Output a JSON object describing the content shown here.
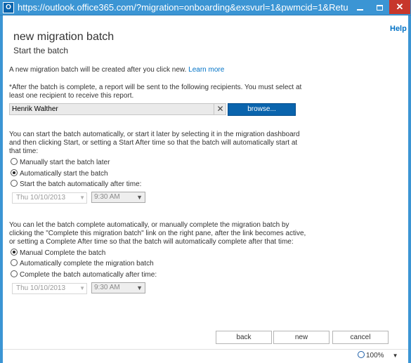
{
  "window": {
    "app_icon_letter": "O",
    "url": "https://outlook.office365.com/?migration=onboarding&exsvurl=1&pwmcid=1&ReturnObj...",
    "min_icon": "minimize-icon",
    "max_icon": "maximize-icon",
    "close_icon": "close-icon",
    "close_glyph": "✕"
  },
  "header": {
    "help_label": "Help",
    "title": "new migration batch",
    "subtitle": "Start the batch"
  },
  "intro": {
    "text": "A new migration batch will be created after you click new.",
    "learn_more": "Learn more"
  },
  "report": {
    "line1": "*After the batch is complete, a report will be sent to the following recipients. You must select at",
    "line2": "least one recipient to receive this report.",
    "recipient": "Henrik Walther",
    "remove_glyph": "✕",
    "browse_label": "browse..."
  },
  "start": {
    "desc_line1": "You can start the batch automatically, or start it later by selecting it in the migration dashboard",
    "desc_line2": "and then clicking Start, or setting a Start After time so that the batch will automatically start at",
    "desc_line3": "that time:",
    "options": [
      {
        "label": "Manually start the batch later",
        "checked": false
      },
      {
        "label": "Automatically start the batch",
        "checked": true
      },
      {
        "label": "Start the batch automatically after time:",
        "checked": false
      }
    ],
    "date": "Thu 10/10/2013",
    "time": "9:30 AM"
  },
  "complete": {
    "desc_line1": "You can let the batch complete automatically, or manually complete the migration batch by",
    "desc_line2": "clicking the \"Complete this migration batch\" link on the right pane, after the link becomes active,",
    "desc_line3": "or setting a Complete After time so that the batch will automatically complete after that time:",
    "options": [
      {
        "label": "Manual Complete the batch",
        "checked": true
      },
      {
        "label": "Automatically complete the migration batch",
        "checked": false
      },
      {
        "label": "Complete the batch automatically after time:",
        "checked": false
      }
    ],
    "date": "Thu 10/10/2013",
    "time": "9:30 AM"
  },
  "footer": {
    "back_label": "back",
    "new_label": "new",
    "cancel_label": "cancel",
    "zoom": "100%"
  }
}
